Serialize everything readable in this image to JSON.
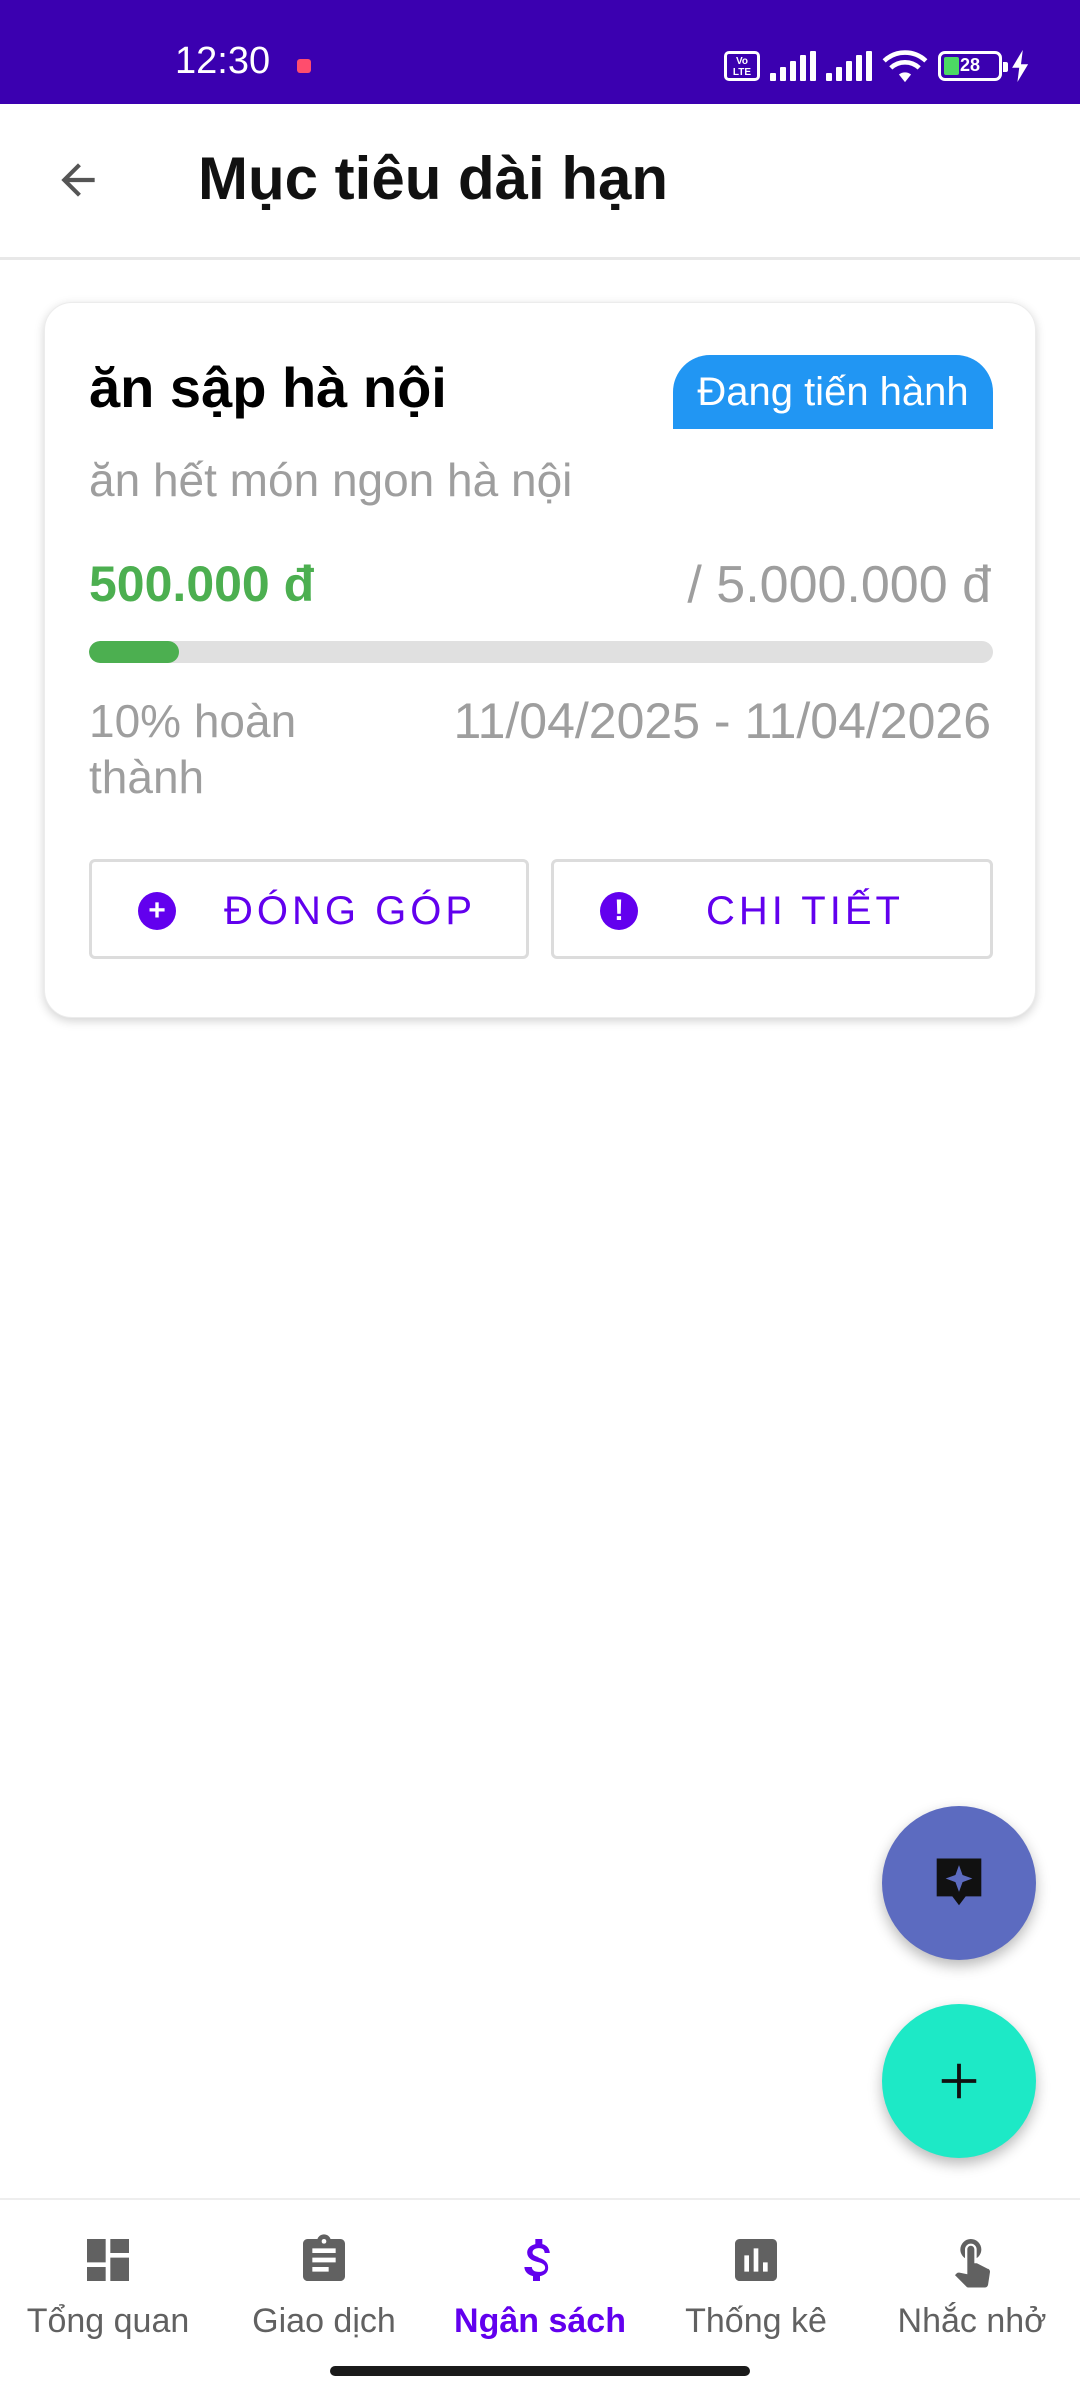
{
  "status_bar": {
    "time": "12:30",
    "volte_label": "Vo\nLTE",
    "battery_level": "28",
    "battery_fraction": 0.28
  },
  "app_bar": {
    "title": "Mục tiêu dài hạn",
    "back_icon": "arrow-back-icon"
  },
  "goal_card": {
    "name": "ăn sập hà nội",
    "status": "Đang tiến hành",
    "description": "ăn hết món ngon hà nội",
    "current_amount": "500.000 đ",
    "target_amount": "/ 5.000.000 đ",
    "progress_fraction": 0.1,
    "percent_text": "10% hoàn thành",
    "date_range": "11/04/2025 - 11/04/2026",
    "contribute_label": "ĐÓNG GÓP",
    "detail_label": "CHI TIẾT"
  },
  "fabs": {
    "ai_icon": "sparkle-chat-icon",
    "add_icon": "plus-icon"
  },
  "bottom_nav": {
    "items": [
      {
        "label": "Tổng quan",
        "icon": "dashboard-icon"
      },
      {
        "label": "Giao dịch",
        "icon": "clipboard-icon"
      },
      {
        "label": "Ngân sách",
        "icon": "dollar-icon"
      },
      {
        "label": "Thống kê",
        "icon": "bar-chart-icon"
      },
      {
        "label": "Nhắc nhở",
        "icon": "touch-icon"
      }
    ],
    "active_index": 2
  },
  "colors": {
    "status_bar": "#3b00b0",
    "primary": "#6200ee",
    "badge": "#2196f3",
    "amount_green": "#4caf50",
    "fab_ai": "#5c6bc0",
    "fab_add": "#1de9c6"
  }
}
